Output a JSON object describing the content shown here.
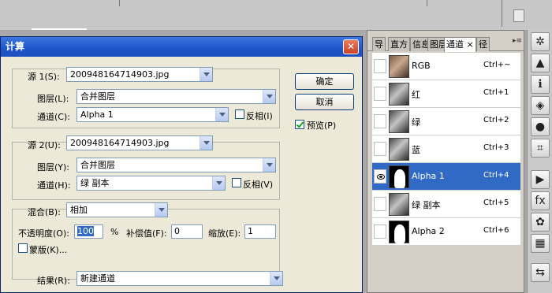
{
  "dialog": {
    "title": "计算",
    "close": "✕",
    "source1": {
      "label": "源 1(S):",
      "file": "200948164714903.jpg",
      "layer_label": "图层(L):",
      "layer": "合并图层",
      "channel_label": "通道(C):",
      "channel": "Alpha 1",
      "invert_label": "反相(I)"
    },
    "source2": {
      "label": "源 2(U):",
      "file": "200948164714903.jpg",
      "layer_label": "图层(Y):",
      "layer": "合并图层",
      "channel_label": "通道(H):",
      "channel": "绿 副本",
      "invert_label": "反相(V)"
    },
    "blend": {
      "label": "混合(B):",
      "mode": "相加",
      "opacity_label": "不透明度(O):",
      "opacity": "100",
      "percent": "%",
      "offset_label": "补偿值(F):",
      "offset": "0",
      "scale_label": "缩放(E):",
      "scale": "1",
      "mask_label": "蒙版(K)..."
    },
    "result": {
      "label": "结果(R):",
      "value": "新建通道"
    },
    "buttons": {
      "ok": "确定",
      "cancel": "取消",
      "preview": "预览(P)"
    }
  },
  "panel": {
    "tabs": [
      "导",
      "直方",
      "信息",
      "图层",
      "通道",
      "径"
    ],
    "active_tab": "通道",
    "tab_close": "×",
    "menu_icon": "▸≡",
    "channels": [
      {
        "name": "RGB",
        "shortcut": "Ctrl+~",
        "thumb": "rgb",
        "visible": false,
        "selected": false
      },
      {
        "name": "红",
        "shortcut": "Ctrl+1",
        "thumb": "gray",
        "visible": false,
        "selected": false
      },
      {
        "name": "绿",
        "shortcut": "Ctrl+2",
        "thumb": "gray",
        "visible": false,
        "selected": false
      },
      {
        "name": "蓝",
        "shortcut": "Ctrl+3",
        "thumb": "gray",
        "visible": false,
        "selected": false
      },
      {
        "name": "Alpha 1",
        "shortcut": "Ctrl+4",
        "thumb": "alpha",
        "visible": true,
        "selected": true
      },
      {
        "name": "绿 副本",
        "shortcut": "Ctrl+5",
        "thumb": "gray",
        "visible": false,
        "selected": false
      },
      {
        "name": "Alpha 2",
        "shortcut": "Ctrl+6",
        "thumb": "alpha",
        "visible": false,
        "selected": false
      }
    ]
  },
  "toolbar": {
    "icons": [
      {
        "name": "navigator-icon",
        "glyph": "✲"
      },
      {
        "name": "histogram-icon",
        "glyph": "▲"
      },
      {
        "name": "info-icon",
        "glyph": "ℹ"
      },
      {
        "name": "layers-icon",
        "glyph": "◈"
      },
      {
        "name": "channels-icon",
        "glyph": "●"
      },
      {
        "name": "paths-icon",
        "glyph": "⌗"
      },
      {
        "name": "actions-icon",
        "glyph": "▶"
      },
      {
        "name": "fx-icon",
        "glyph": "fx"
      },
      {
        "name": "color-icon",
        "glyph": "✿"
      },
      {
        "name": "swatches-icon",
        "glyph": "▦"
      },
      {
        "name": "history-icon",
        "glyph": "⇆"
      }
    ]
  }
}
